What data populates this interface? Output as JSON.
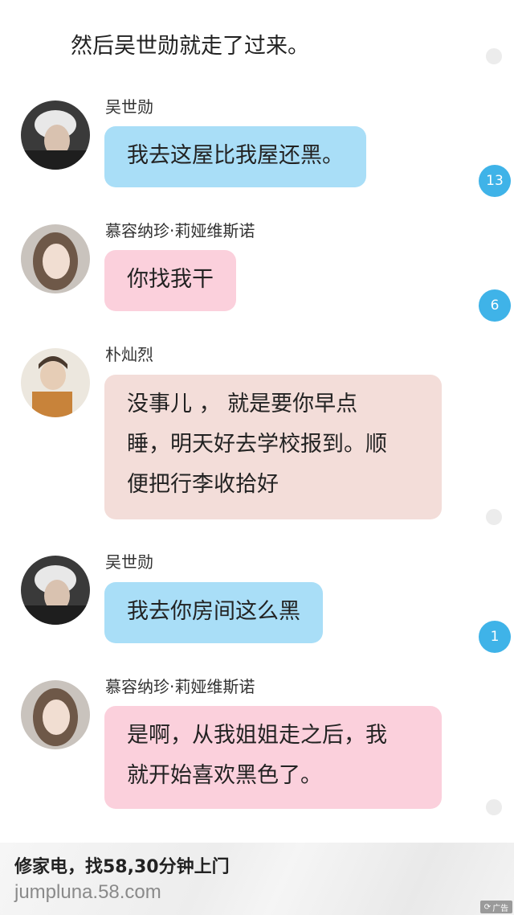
{
  "narration": "然后吴世勋就走了过来。",
  "messages": [
    {
      "name": "吴世勋",
      "text": "我去这屋比我屋还黑。",
      "badge": "13"
    },
    {
      "name": "慕容纳珍·莉娅维斯诺",
      "text": "你找我干",
      "badge": "6"
    },
    {
      "name": "朴灿烈",
      "lines": [
        "没事儿 ， 就是要你早点",
        "睡，明天好去学校报到。顺",
        "便把行李收拾好"
      ]
    },
    {
      "name": "吴世勋",
      "text": "我去你房间这么黑",
      "badge": "1"
    },
    {
      "name": "慕容纳珍·莉娅维斯诺",
      "lines": [
        "是啊，从我姐姐走之后，我",
        "就开始喜欢黑色了。"
      ]
    }
  ],
  "ad": {
    "title": "修家电，找58,30分钟上门",
    "url": "jumpluna.58.com",
    "tag": "广告"
  },
  "colors": {
    "blue_bubble": "#a9def7",
    "pink_bubble": "#fbd0dc",
    "beige_bubble": "#f3ddd9",
    "badge": "#3fb3e8"
  }
}
